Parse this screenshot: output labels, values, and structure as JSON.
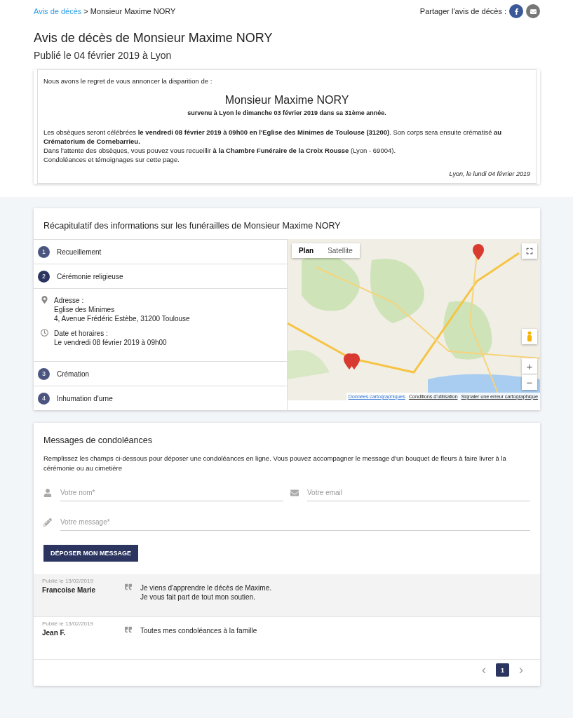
{
  "breadcrumb": {
    "link": "Avis de décès",
    "separator": ">",
    "current": "Monsieur Maxime NORY"
  },
  "share": {
    "label": "Partager l'avis de décès :",
    "buttons": [
      {
        "kind": "facebook"
      },
      {
        "kind": "email"
      }
    ]
  },
  "title": "Avis de décès de Monsieur Maxime NORY",
  "subtitle": "Publié le 04 février 2019 à Lyon",
  "notice": {
    "intro": "Nous avons le regret de vous annoncer la disparition de :",
    "name": "Monsieur Maxime NORY",
    "death": "survenu à Lyon le dimanche 03 février 2019 dans sa 31ème année.",
    "paragraphs": [
      "Les obsèques seront célébrées **le vendredi 08 février 2019 à 09h00 en l'Eglise des Minimes de Toulouse (31200)**. Son corps sera ensuite crématisé **au Crématorium de Cornebarrieu.**",
      "Dans l'attente des obsèques, vous pouvez vous recueillir **à la Chambre Funéraire de la Croix Rousse** (Lyon - 69004).",
      "Condoléances et témoignages sur cette page."
    ],
    "signature": "Lyon, le lundi 04 février 2019"
  },
  "recap": {
    "title": "Récapitulatif des informations sur les funérailles de Monsieur Maxime NORY",
    "steps": [
      {
        "number": "1",
        "label": "Recueillement",
        "expanded": false
      },
      {
        "number": "2",
        "label": "Cérémonie religieuse",
        "expanded": true,
        "details": [
          {
            "kind": "pin",
            "label": "Adresse :",
            "lines": [
              "Eglise des Minimes",
              "4, Avenue Frédéric Estèbe, 31200 Toulouse"
            ]
          },
          {
            "kind": "clock",
            "label": "Date et horaires :",
            "lines": [
              "Le vendredi 08 février 2019 à 09h00"
            ]
          }
        ]
      },
      {
        "number": "3",
        "label": "Crémation",
        "expanded": false
      },
      {
        "number": "4",
        "label": "Inhumation d'urne",
        "expanded": false
      }
    ],
    "map": {
      "kind": "picture",
      "types": [
        {
          "label": "Plan",
          "selected": true
        },
        {
          "label": "Satellite",
          "selected": false
        }
      ],
      "zoom_in": "+",
      "zoom_out": "−",
      "footer": [
        "Données cartographiques",
        "Conditions d'utilisation",
        "Signaler une erreur cartographique"
      ]
    }
  },
  "condolences": {
    "title": "Messages de condoléances",
    "description": "Remplissez les champs ci-dessous pour déposer une condoléances en ligne. Vous pouvez accompagner le message d'un bouquet de fleurs à faire livrer à la cérémonie ou au cimetière",
    "fields": [
      {
        "kind": "person",
        "placeholder": "Votre nom*"
      },
      {
        "kind": "email",
        "placeholder": "Votre email"
      },
      {
        "kind": "pencil",
        "placeholder": "Votre message*"
      }
    ],
    "submit": "DÉPOSER MON MESSAGE",
    "messages": [
      {
        "date": "Publié le 13/02/2019",
        "author": "Francoise Marie",
        "lines": [
          "Je viens d'apprendre le décès de Maxime.",
          "Je vous fait part de tout mon soutien."
        ],
        "highlighted": true
      },
      {
        "date": "Publié le 13/02/2019",
        "author": "Jean F.",
        "lines": [
          "Toutes mes condoléances à la famille"
        ],
        "highlighted": false
      }
    ],
    "pagination": {
      "prev": "‹",
      "pages": [
        {
          "label": "1",
          "selected": true
        }
      ],
      "next": "›"
    }
  }
}
